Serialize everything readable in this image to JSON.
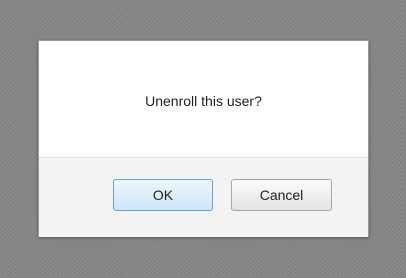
{
  "dialog": {
    "message": "Unenroll this user?",
    "buttons": {
      "ok_label": "OK",
      "cancel_label": "Cancel"
    }
  },
  "colors": {
    "overlay": "#868686",
    "dialog_background": "#ffffff",
    "footer_background": "#f3f3f3",
    "ok_button_border": "#6ca1c9",
    "ok_button_fill": "#cde6f8",
    "cancel_button_fill": "#e3e3e3"
  }
}
